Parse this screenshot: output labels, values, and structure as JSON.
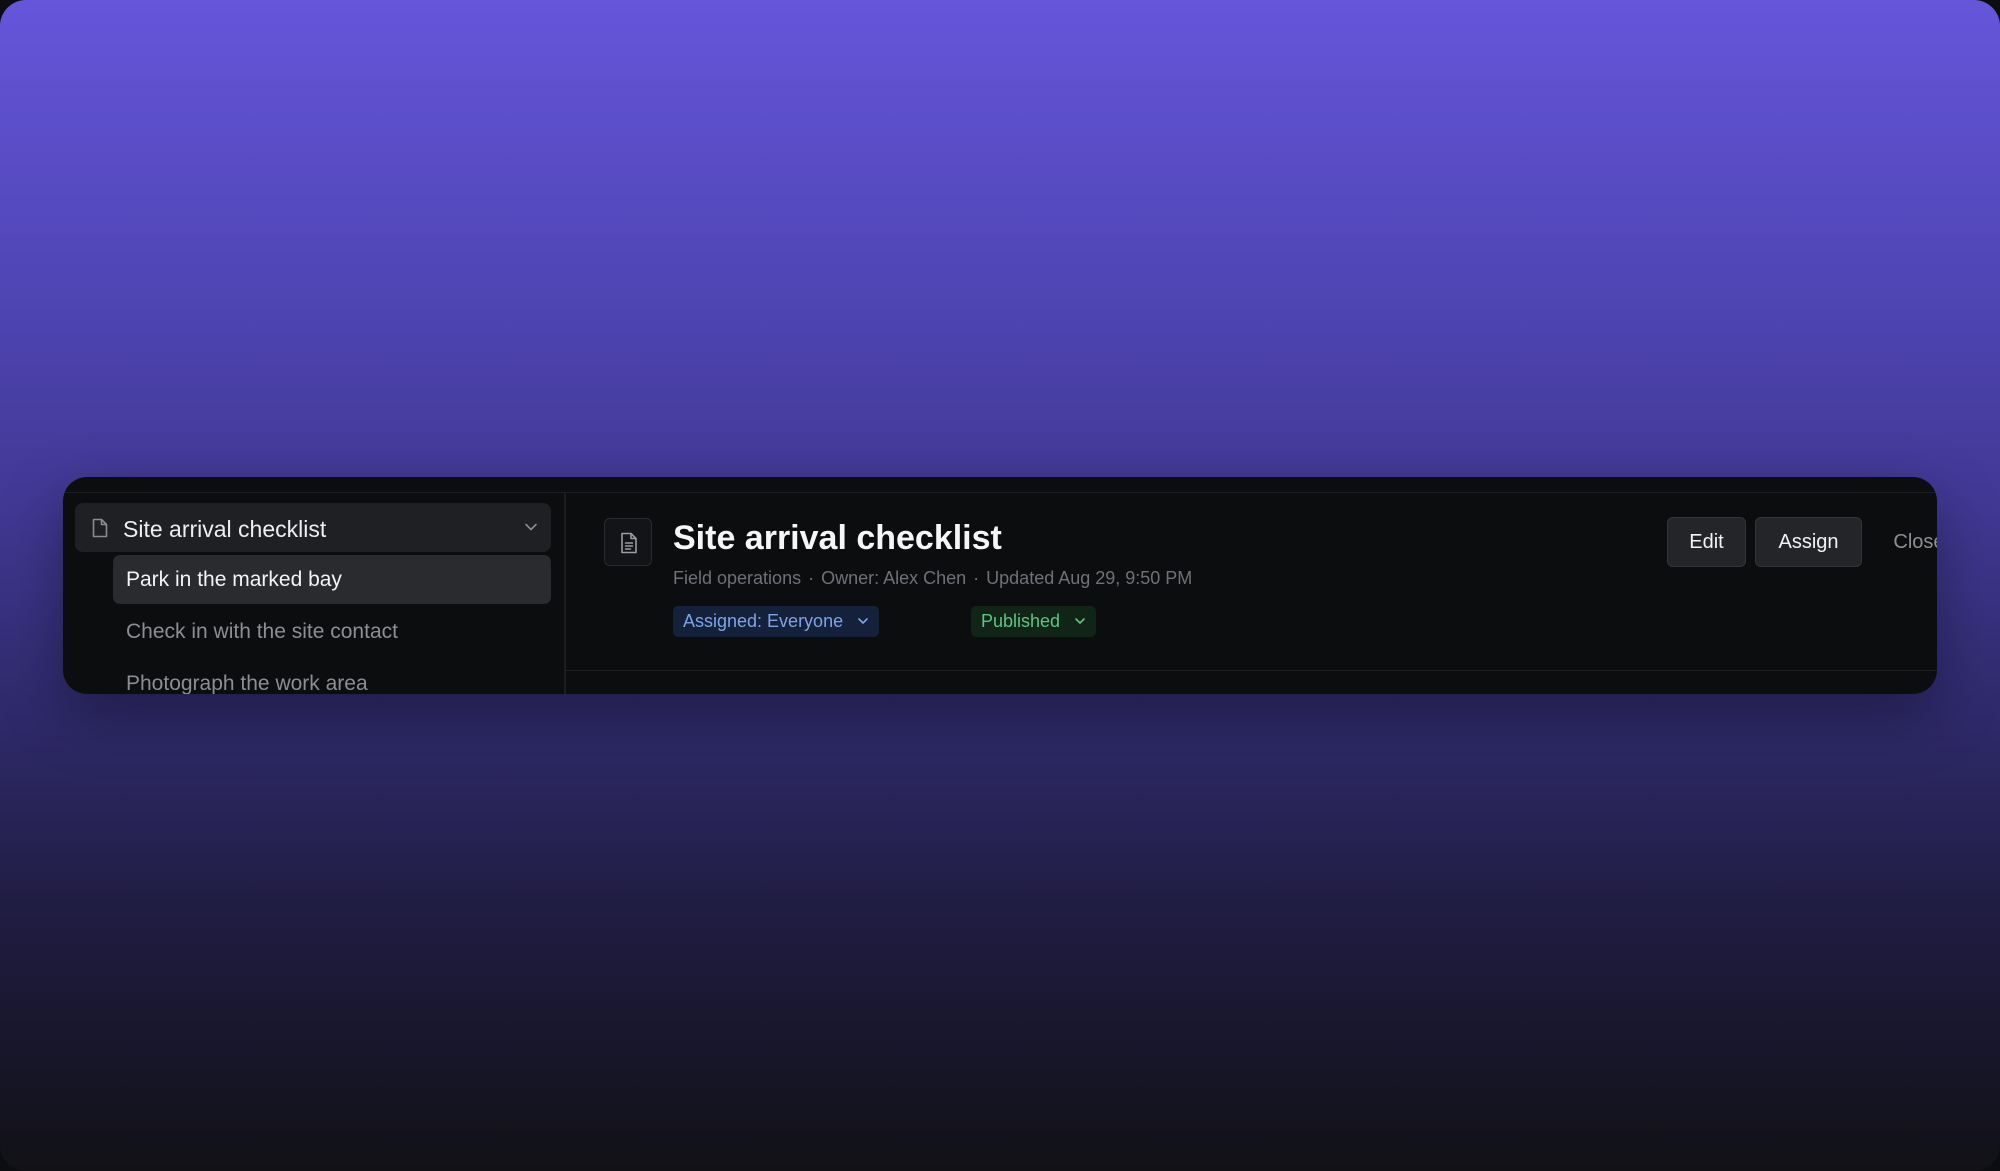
{
  "sidebar": {
    "header_title": "Site arrival checklist",
    "items": [
      {
        "label": "Park in the marked bay"
      },
      {
        "label": "Check in with the site contact"
      },
      {
        "label": "Photograph the work area"
      }
    ]
  },
  "main": {
    "title": "Site arrival checklist",
    "meta": {
      "category": "Field operations",
      "owner": "Owner: Alex Chen",
      "updated": "Updated Aug 29, 9:50 PM",
      "separator": "·"
    },
    "badges": {
      "assigned": "Assigned: Everyone",
      "status": "Published"
    },
    "actions": {
      "edit": "Edit",
      "assign": "Assign",
      "close": "Close"
    }
  },
  "colors": {
    "gradient_top": "#6556da",
    "gradient_bottom": "#111116",
    "panel_bg": "#0c0d0f",
    "assigned_badge_text": "#7fa4e6",
    "published_badge_text": "#5bc582"
  },
  "icons": {
    "sidebar_header": "file-icon",
    "sidebar_chevron": "chevron-down-icon",
    "main_tile": "document-text-icon",
    "badge_chevron": "chevron-down-icon"
  }
}
